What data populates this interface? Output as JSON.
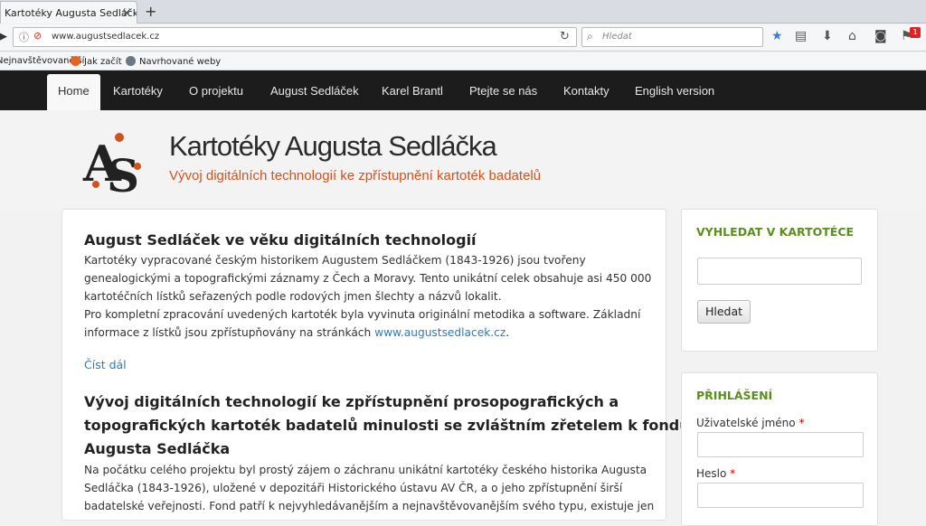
{
  "browser": {
    "tab_title": "Kartotéky Augusta Sedláčka",
    "tab_close": "×",
    "new_tab": "+",
    "url": "www.augustsedlacek.cz",
    "search_placeholder": "Hledat",
    "notification_count": "1",
    "bookmarks": [
      "Nejnavštěvovanější",
      "Jak začít",
      "Navrhované weby"
    ]
  },
  "site_nav": {
    "items": [
      "Home",
      "Kartotéky",
      "O projektu",
      "August Sedláček",
      "Karel Brantl",
      "Ptejte se nás",
      "Kontakty",
      "English version"
    ],
    "active": "Home"
  },
  "header": {
    "title": "Kartotéky Augusta Sedláčka",
    "subtitle": "Vývoj digitálních technologií ke zpřístupnění kartoték badatelů"
  },
  "article1": {
    "title": "August Sedláček ve věku digitálních technologií",
    "lines": [
      "Kartotéky vypracované českým historikem Augustem Sedláčkem (1843-1926) jsou tvořeny",
      "genealogickými a topografickými záznamy z Čech a Moravy. Tento unikátní celek obsahuje asi 450 000",
      "kartotéčních lístků seřazených podle rodových jmen šlechty a názvů lokalit."
    ],
    "lines2": [
      "Pro kompletní zpracování uvedených kartoték byla vyvinuta originální metodika a software. Základní"
    ],
    "line_prefix": "informace z lístků jsou zpřístupňovány na stránkách ",
    "link": "www.augustsedlacek.cz",
    "line_suffix": ".",
    "read_more": "Číst dál"
  },
  "article2": {
    "title_lines": [
      "Vývoj digitálních technologií ke zpřístupnění prosopografických a",
      "topografických kartoték badatelů minulosti se zvláštním zřetelem k fondu",
      "Augusta Sedláčka"
    ],
    "lines": [
      "Na počátku celého projektu byl prostý zájem o záchranu unikátní kartotéky českého historika Augusta",
      "Sedláčka (1843-1926), uložené v depozitáři Historického ústavu AV ČR, a o jeho zpřístupnění širší",
      "badatelské veřejnosti. Fond patří k nejvyhledávanějším a nejnavštěvovanějším svého typu, existuje jen"
    ]
  },
  "sidebar": {
    "search_title": "VYHLEDAT V KARTOTÉCE",
    "search_button": "Hledat",
    "login_title": "PŘIHLÁŠENÍ",
    "username_label": "Uživatelské jméno",
    "password_label": "Heslo",
    "required_mark": "*"
  }
}
